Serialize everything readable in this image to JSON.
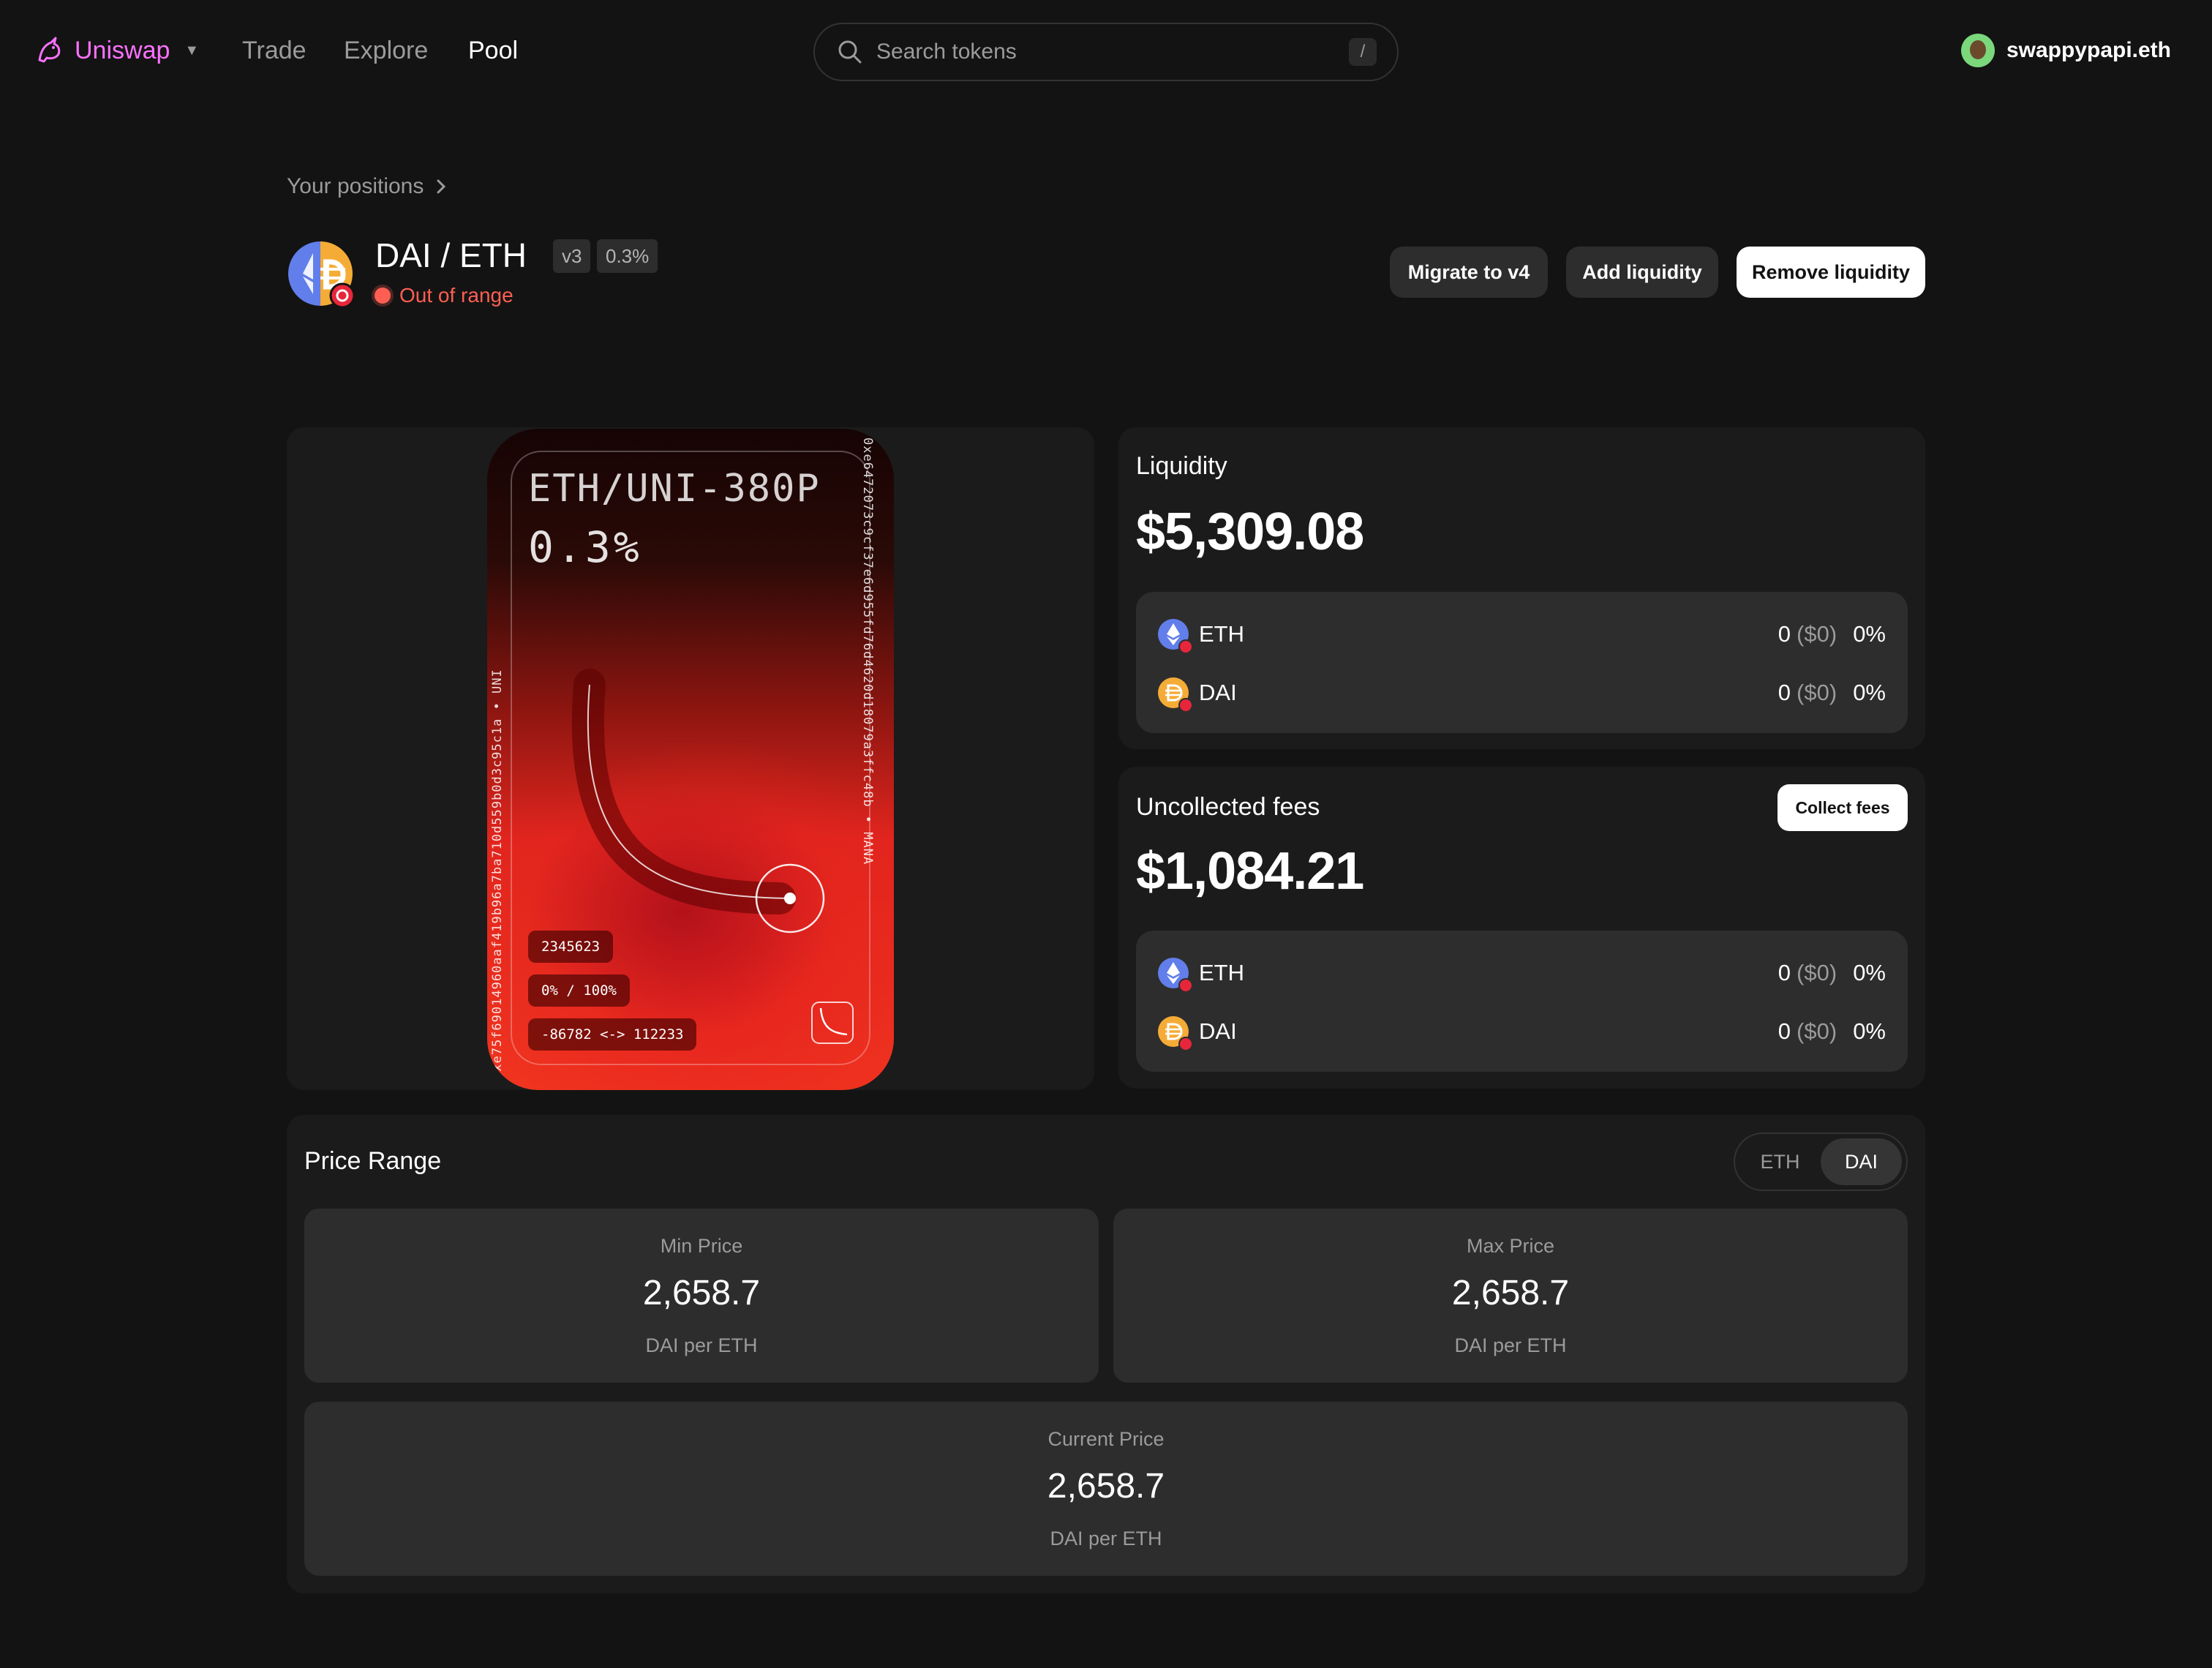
{
  "header": {
    "brand": "Uniswap",
    "nav": [
      "Trade",
      "Explore",
      "Pool"
    ],
    "active_nav": "Pool",
    "search": {
      "placeholder": "Search tokens",
      "shortcut": "/"
    },
    "account": "swappypapi.eth"
  },
  "position": {
    "breadcrumb": "Your positions",
    "pair": "DAI / ETH",
    "version": "v3",
    "fee_tier": "0.3%",
    "status": "Out of range",
    "actions": {
      "migrate": "Migrate to v4",
      "add": "Add liquidity",
      "remove": "Remove liquidity"
    }
  },
  "nft": {
    "title": "ETH/UNI-380P",
    "fee": "0.3%",
    "token_id": "2345623",
    "range_pct": "0% / 100%",
    "ticks": "-86782 <-> 112233",
    "right_edge": "0xe6472073c9cf37e6d955fd76d4620d18079a3ffc48b • MANA",
    "left_edge": "0xe75f69014960aaf419b96a7ba710d559b0d3c95c1a • UNI"
  },
  "liquidity": {
    "title": "Liquidity",
    "value": "$5,309.08",
    "tokens": [
      {
        "symbol": "ETH",
        "amount": "0",
        "usd": "($0)",
        "pct": "0%"
      },
      {
        "symbol": "DAI",
        "amount": "0",
        "usd": "($0)",
        "pct": "0%"
      }
    ]
  },
  "fees": {
    "title": "Uncollected fees",
    "collect_label": "Collect fees",
    "value": "$1,084.21",
    "tokens": [
      {
        "symbol": "ETH",
        "amount": "0",
        "usd": "($0)",
        "pct": "0%"
      },
      {
        "symbol": "DAI",
        "amount": "0",
        "usd": "($0)",
        "pct": "0%"
      }
    ]
  },
  "price_range": {
    "title": "Price Range",
    "toggle": [
      "ETH",
      "DAI"
    ],
    "selected": "DAI",
    "min": {
      "label": "Min Price",
      "value": "2,658.7",
      "unit": "DAI per ETH"
    },
    "max": {
      "label": "Max Price",
      "value": "2,658.7",
      "unit": "DAI per ETH"
    },
    "current": {
      "label": "Current Price",
      "value": "2,658.7",
      "unit": "DAI per ETH"
    }
  },
  "colors": {
    "background": "#131313",
    "panel": "#1b1b1b",
    "surface": "#2d2d2d",
    "brand_pink": "#fc72ff",
    "error_red": "#ff5f52",
    "eth_blue": "#627eea",
    "dai_yellow": "#f5ac37"
  }
}
